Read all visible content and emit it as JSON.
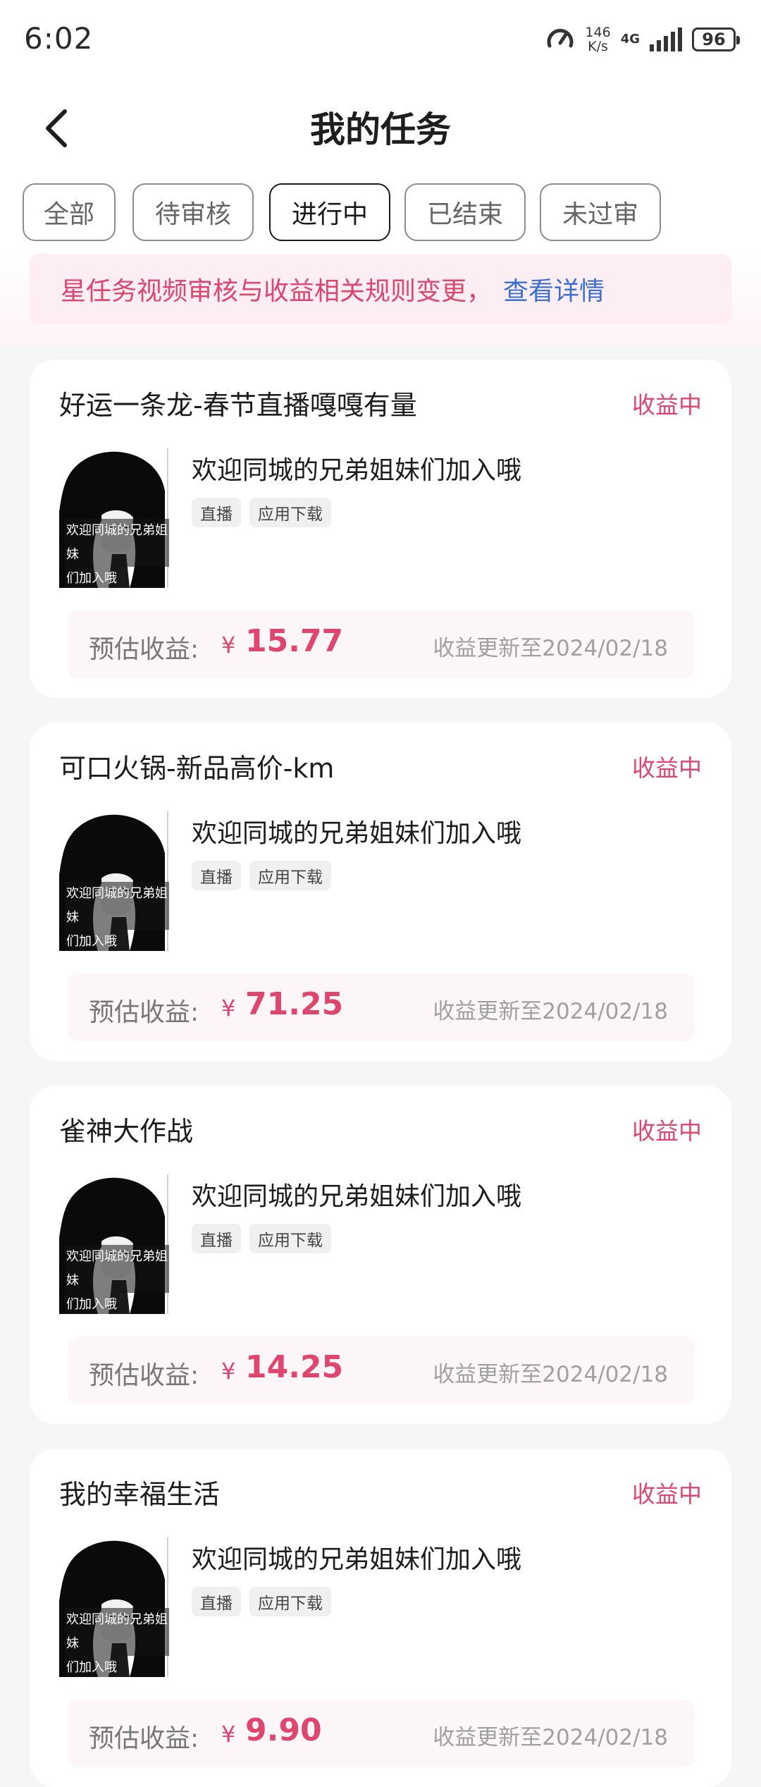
{
  "status_bar": {
    "time": "6:02",
    "speed_value": "146",
    "speed_unit": "K/s",
    "network": "4G",
    "battery": "96"
  },
  "header": {
    "title": "我的任务"
  },
  "tabs": [
    {
      "label": "全部"
    },
    {
      "label": "待审核"
    },
    {
      "label": "进行中"
    },
    {
      "label": "已结束"
    },
    {
      "label": "未过审"
    }
  ],
  "active_tab": "进行中",
  "notice": {
    "text": "星任务视频审核与收益相关规则变更，",
    "link": "查看详情"
  },
  "colors": {
    "accent": "#e0456e",
    "link": "#3b6fd6"
  },
  "tasks": [
    {
      "title": "好运一条龙-春节直播嘎嘎有量",
      "status": "收益中",
      "description": "欢迎同城的兄弟姐妹们加入哦",
      "thumb_caption_1": "欢迎同城的兄弟姐妹",
      "thumb_caption_2": "们加入哦",
      "tags": [
        "直播",
        "应用下载"
      ],
      "earn_label": "预估收益:",
      "currency": "¥",
      "earnings": "15.77",
      "updated": "收益更新至2024/02/18"
    },
    {
      "title": "可口火锅-新品高价-km",
      "status": "收益中",
      "description": "欢迎同城的兄弟姐妹们加入哦",
      "thumb_caption_1": "欢迎同城的兄弟姐妹",
      "thumb_caption_2": "们加入哦",
      "tags": [
        "直播",
        "应用下载"
      ],
      "earn_label": "预估收益:",
      "currency": "¥",
      "earnings": "71.25",
      "updated": "收益更新至2024/02/18"
    },
    {
      "title": "雀神大作战",
      "status": "收益中",
      "description": "欢迎同城的兄弟姐妹们加入哦",
      "thumb_caption_1": "欢迎同城的兄弟姐妹",
      "thumb_caption_2": "们加入哦",
      "tags": [
        "直播",
        "应用下载"
      ],
      "earn_label": "预估收益:",
      "currency": "¥",
      "earnings": "14.25",
      "updated": "收益更新至2024/02/18"
    },
    {
      "title": "我的幸福生活",
      "status": "收益中",
      "description": "欢迎同城的兄弟姐妹们加入哦",
      "thumb_caption_1": "欢迎同城的兄弟姐妹",
      "thumb_caption_2": "们加入哦",
      "tags": [
        "直播",
        "应用下载"
      ],
      "earn_label": "预估收益:",
      "currency": "¥",
      "earnings": "9.90",
      "updated": "收益更新至2024/02/18"
    }
  ]
}
